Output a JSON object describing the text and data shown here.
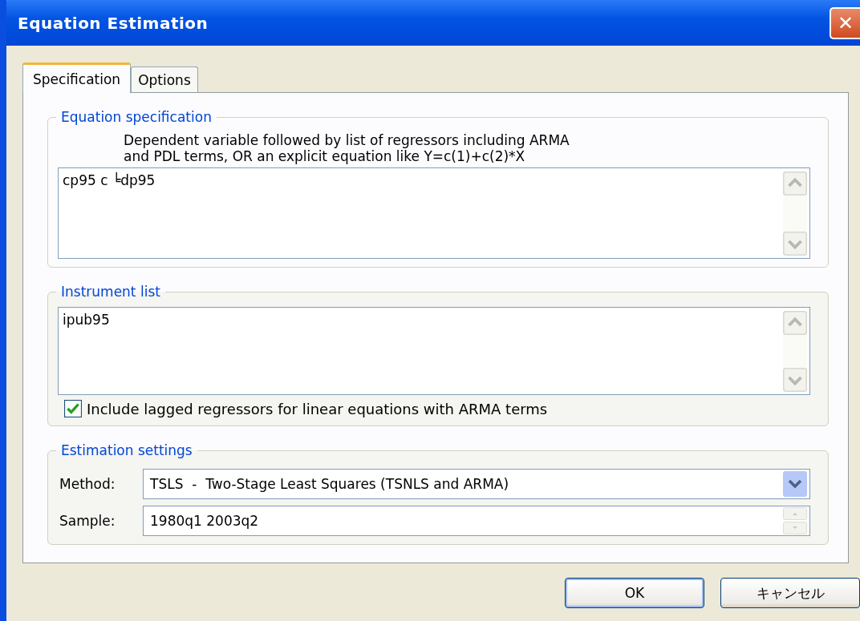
{
  "window": {
    "title": "Equation Estimation",
    "close": "✕"
  },
  "tabs": [
    {
      "label": "Specification",
      "selected": true
    },
    {
      "label": "Options",
      "selected": false
    }
  ],
  "equation_group": {
    "legend": "Equation specification",
    "hint_lines": [
      "Dependent variable followed by list of regressors including ARMA",
      "and PDL terms, OR an explicit equation like Y=c(1)+c(2)*X"
    ],
    "value": "cp95 c ╘dp95"
  },
  "instrument_group": {
    "legend": "Instrument list",
    "value": "ipub95",
    "checkbox": {
      "label": "Include lagged regressors for linear equations with ARMA terms",
      "checked": true
    }
  },
  "settings_group": {
    "legend": "Estimation settings",
    "method_label": "Method:",
    "method": "TSLS  -  Two-Stage Least Squares (TSNLS and ARMA)",
    "sample_label": "Sample:",
    "sample": "1980q1 2003q2"
  },
  "buttons": [
    {
      "label": "OK",
      "kind": "default"
    },
    {
      "label": "キャンセル",
      "kind": "normal"
    }
  ]
}
